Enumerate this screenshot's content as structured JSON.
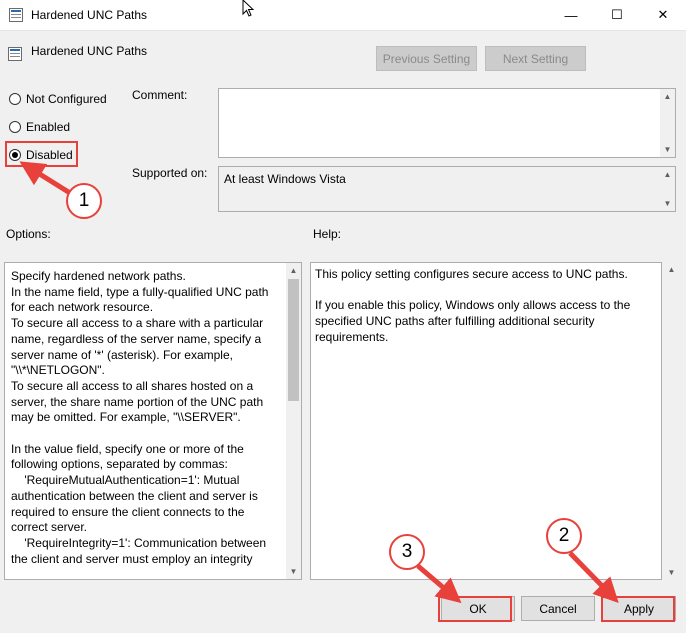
{
  "window": {
    "title": "Hardened UNC Paths",
    "minimize_glyph": "—",
    "maximize_glyph": "☐",
    "close_glyph": "✕"
  },
  "header": {
    "policy_title": "Hardened UNC Paths",
    "previous_label": "Previous Setting",
    "next_label": "Next Setting"
  },
  "radios": {
    "not_configured": "Not Configured",
    "enabled": "Enabled",
    "disabled": "Disabled",
    "selected": "Disabled"
  },
  "comment": {
    "label": "Comment:",
    "value": ""
  },
  "supported": {
    "label": "Supported on:",
    "value": "At least Windows Vista"
  },
  "options": {
    "label": "Options:",
    "text": "Specify hardened network paths.\nIn the name field, type a fully-qualified UNC path for each network resource.\nTo secure all access to a share with a particular name, regardless of the server name, specify a server name of '*' (asterisk). For example, \"\\\\*\\NETLOGON\".\nTo secure all access to all shares hosted on a server, the share name portion of the UNC path may be omitted. For example, \"\\\\SERVER\".\n\nIn the value field, specify one or more of the following options, separated by commas:\n    'RequireMutualAuthentication=1': Mutual authentication between the client and server is required to ensure the client connects to the correct server.\n    'RequireIntegrity=1': Communication between the client and server must employ an integrity"
  },
  "help": {
    "label": "Help:",
    "text": "This policy setting configures secure access to UNC paths.\n\nIf you enable this policy, Windows only allows access to the specified UNC paths after fulfilling additional security requirements."
  },
  "buttons": {
    "ok": "OK",
    "cancel": "Cancel",
    "apply": "Apply"
  },
  "annotations": {
    "step1": "1",
    "step2": "2",
    "step3": "3",
    "color": "#e8403a"
  }
}
